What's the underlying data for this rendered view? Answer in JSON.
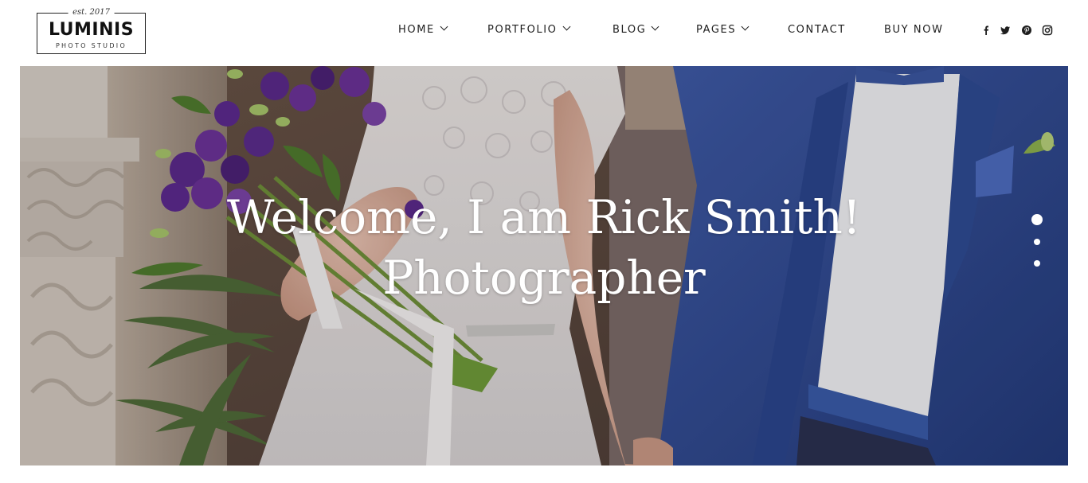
{
  "logo": {
    "est": "est. 2017",
    "name": "LUMINIS",
    "subtitle": "PHOTO STUDIO"
  },
  "nav": {
    "items": [
      {
        "label": "HOME",
        "has_dropdown": true
      },
      {
        "label": "PORTFOLIO",
        "has_dropdown": true
      },
      {
        "label": "BLOG",
        "has_dropdown": true
      },
      {
        "label": "PAGES",
        "has_dropdown": true
      },
      {
        "label": "CONTACT",
        "has_dropdown": false
      },
      {
        "label": "BUY NOW",
        "has_dropdown": false
      }
    ]
  },
  "social": [
    {
      "icon": "facebook-icon"
    },
    {
      "icon": "twitter-icon"
    },
    {
      "icon": "pinterest-icon"
    },
    {
      "icon": "instagram-icon"
    }
  ],
  "hero": {
    "title_line1": "Welcome, I am Rick Smith!",
    "title_line2": "Photographer",
    "slides_total": 3,
    "active_slide": 1
  },
  "colors": {
    "text_dark": "#1e1e1e",
    "hero_text": "#ffffff",
    "suit_blue": "#2f4a93"
  }
}
